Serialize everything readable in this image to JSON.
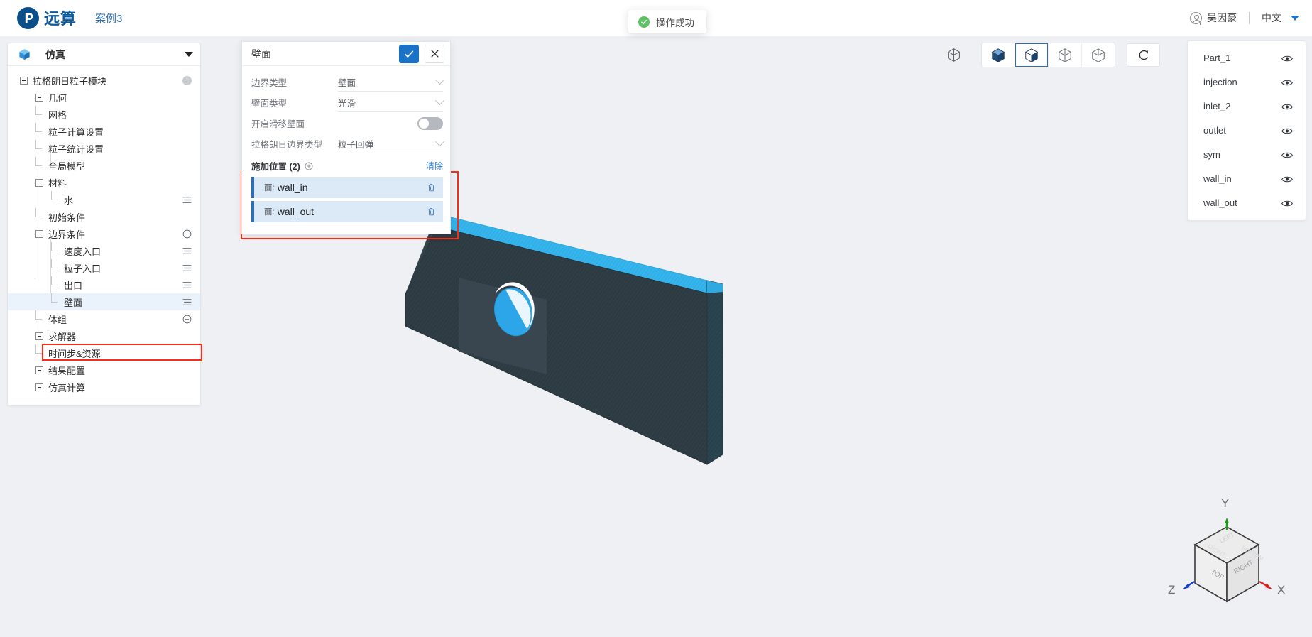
{
  "header": {
    "brand": "远算",
    "case_name": "案例3",
    "user_name": "吴因豪",
    "language": "中文",
    "icons": {
      "avatar": "user-circle-icon",
      "caret": "chevron-down-icon"
    }
  },
  "toast": {
    "message": "操作成功",
    "icon": "check-circle-icon",
    "color": "#5dc264"
  },
  "tree_panel": {
    "title": "仿真",
    "icon": "cube-icon",
    "rows": [
      {
        "label": "拉格朗日粒子模块",
        "indent": 0,
        "toggle": "minus",
        "action": "info",
        "selected": false
      },
      {
        "label": "几何",
        "indent": 1,
        "toggle": "plus",
        "action": "none",
        "selected": false
      },
      {
        "label": "网格",
        "indent": 1,
        "toggle": "tee",
        "action": "none",
        "selected": false
      },
      {
        "label": "粒子计算设置",
        "indent": 1,
        "toggle": "tee",
        "action": "none",
        "selected": false
      },
      {
        "label": "粒子统计设置",
        "indent": 1,
        "toggle": "tee",
        "action": "none",
        "selected": false
      },
      {
        "label": "全局模型",
        "indent": 1,
        "toggle": "tee",
        "action": "none",
        "selected": false
      },
      {
        "label": "材料",
        "indent": 1,
        "toggle": "minus",
        "action": "none",
        "selected": false
      },
      {
        "label": "水",
        "indent": 2,
        "toggle": "elbow",
        "action": "menu",
        "selected": false
      },
      {
        "label": "初始条件",
        "indent": 1,
        "toggle": "tee",
        "action": "none",
        "selected": false
      },
      {
        "label": "边界条件",
        "indent": 1,
        "toggle": "minus",
        "action": "plus",
        "selected": false
      },
      {
        "label": "速度入口",
        "indent": 2,
        "toggle": "tee",
        "action": "menu",
        "selected": false
      },
      {
        "label": "粒子入口",
        "indent": 2,
        "toggle": "tee",
        "action": "menu",
        "selected": false
      },
      {
        "label": "出口",
        "indent": 2,
        "toggle": "tee",
        "action": "menu",
        "selected": false
      },
      {
        "label": "壁面",
        "indent": 2,
        "toggle": "elbow",
        "action": "menu",
        "selected": true
      },
      {
        "label": "体组",
        "indent": 1,
        "toggle": "tee",
        "action": "plus",
        "selected": false
      },
      {
        "label": "求解器",
        "indent": 1,
        "toggle": "plus",
        "action": "none",
        "selected": false
      },
      {
        "label": "时间步&资源",
        "indent": 1,
        "toggle": "tee",
        "action": "none",
        "selected": false
      },
      {
        "label": "结果配置",
        "indent": 1,
        "toggle": "plus",
        "action": "none",
        "selected": false
      },
      {
        "label": "仿真计算",
        "indent": 1,
        "toggle": "plus",
        "action": "none",
        "selected": false
      }
    ]
  },
  "dialog": {
    "title": "壁面",
    "ok_icon": "check-icon",
    "cancel_icon": "close-icon",
    "fields": [
      {
        "label": "边界类型",
        "value": "壁面",
        "control": "select"
      },
      {
        "label": "壁面类型",
        "value": "光滑",
        "control": "select"
      },
      {
        "label": "开启滑移壁面",
        "value": "",
        "control": "toggle",
        "on": false
      },
      {
        "label": "拉格朗日边界类型",
        "value": "粒子回弹",
        "control": "select"
      }
    ],
    "section": {
      "title": "施加位置 (2)",
      "add_icon": "plus-circle-icon",
      "clear_label": "清除",
      "items": [
        {
          "prefix": "面:",
          "name": "wall_in",
          "delete_icon": "trash-icon"
        },
        {
          "prefix": "面:",
          "name": "wall_out",
          "delete_icon": "trash-icon"
        }
      ]
    }
  },
  "viewport": {
    "toolbar": [
      {
        "name": "wireframe-cube-icon",
        "active": false,
        "grouped": false
      },
      {
        "name": "solid-blue-cube-icon",
        "active": false,
        "grouped": true
      },
      {
        "name": "half-shaded-cube-icon",
        "active": true,
        "grouped": true
      },
      {
        "name": "outline-cube-icon",
        "active": false,
        "grouped": true
      },
      {
        "name": "edges-cube-icon",
        "active": false,
        "grouped": true
      },
      {
        "name": "reset-view-icon",
        "active": false,
        "grouped": false
      }
    ],
    "gizmo": {
      "axes": [
        {
          "label": "Y",
          "color": "#12a012"
        },
        {
          "label": "X",
          "color": "#e02020"
        },
        {
          "label": "Z",
          "color": "#1a3fd0"
        }
      ],
      "faces": [
        "TOP",
        "RIGHT",
        "LEFT",
        "FRONT",
        "BOTTOM"
      ]
    },
    "geometry": {
      "body_color": "#2f3d45",
      "top_edge_color": "#36b4ec",
      "hole_color": "#2ca6e8",
      "patch_color": "#3a4750"
    }
  },
  "part_panel": {
    "rows": [
      {
        "label": "Part_1",
        "visible_icon": "eye-icon"
      },
      {
        "label": "injection",
        "visible_icon": "eye-icon"
      },
      {
        "label": "inlet_2",
        "visible_icon": "eye-icon"
      },
      {
        "label": "outlet",
        "visible_icon": "eye-icon"
      },
      {
        "label": "sym",
        "visible_icon": "eye-icon"
      },
      {
        "label": "wall_in",
        "visible_icon": "eye-icon"
      },
      {
        "label": "wall_out",
        "visible_icon": "eye-icon"
      }
    ]
  },
  "highlights": {
    "color": "#f42e19",
    "count": 3
  }
}
